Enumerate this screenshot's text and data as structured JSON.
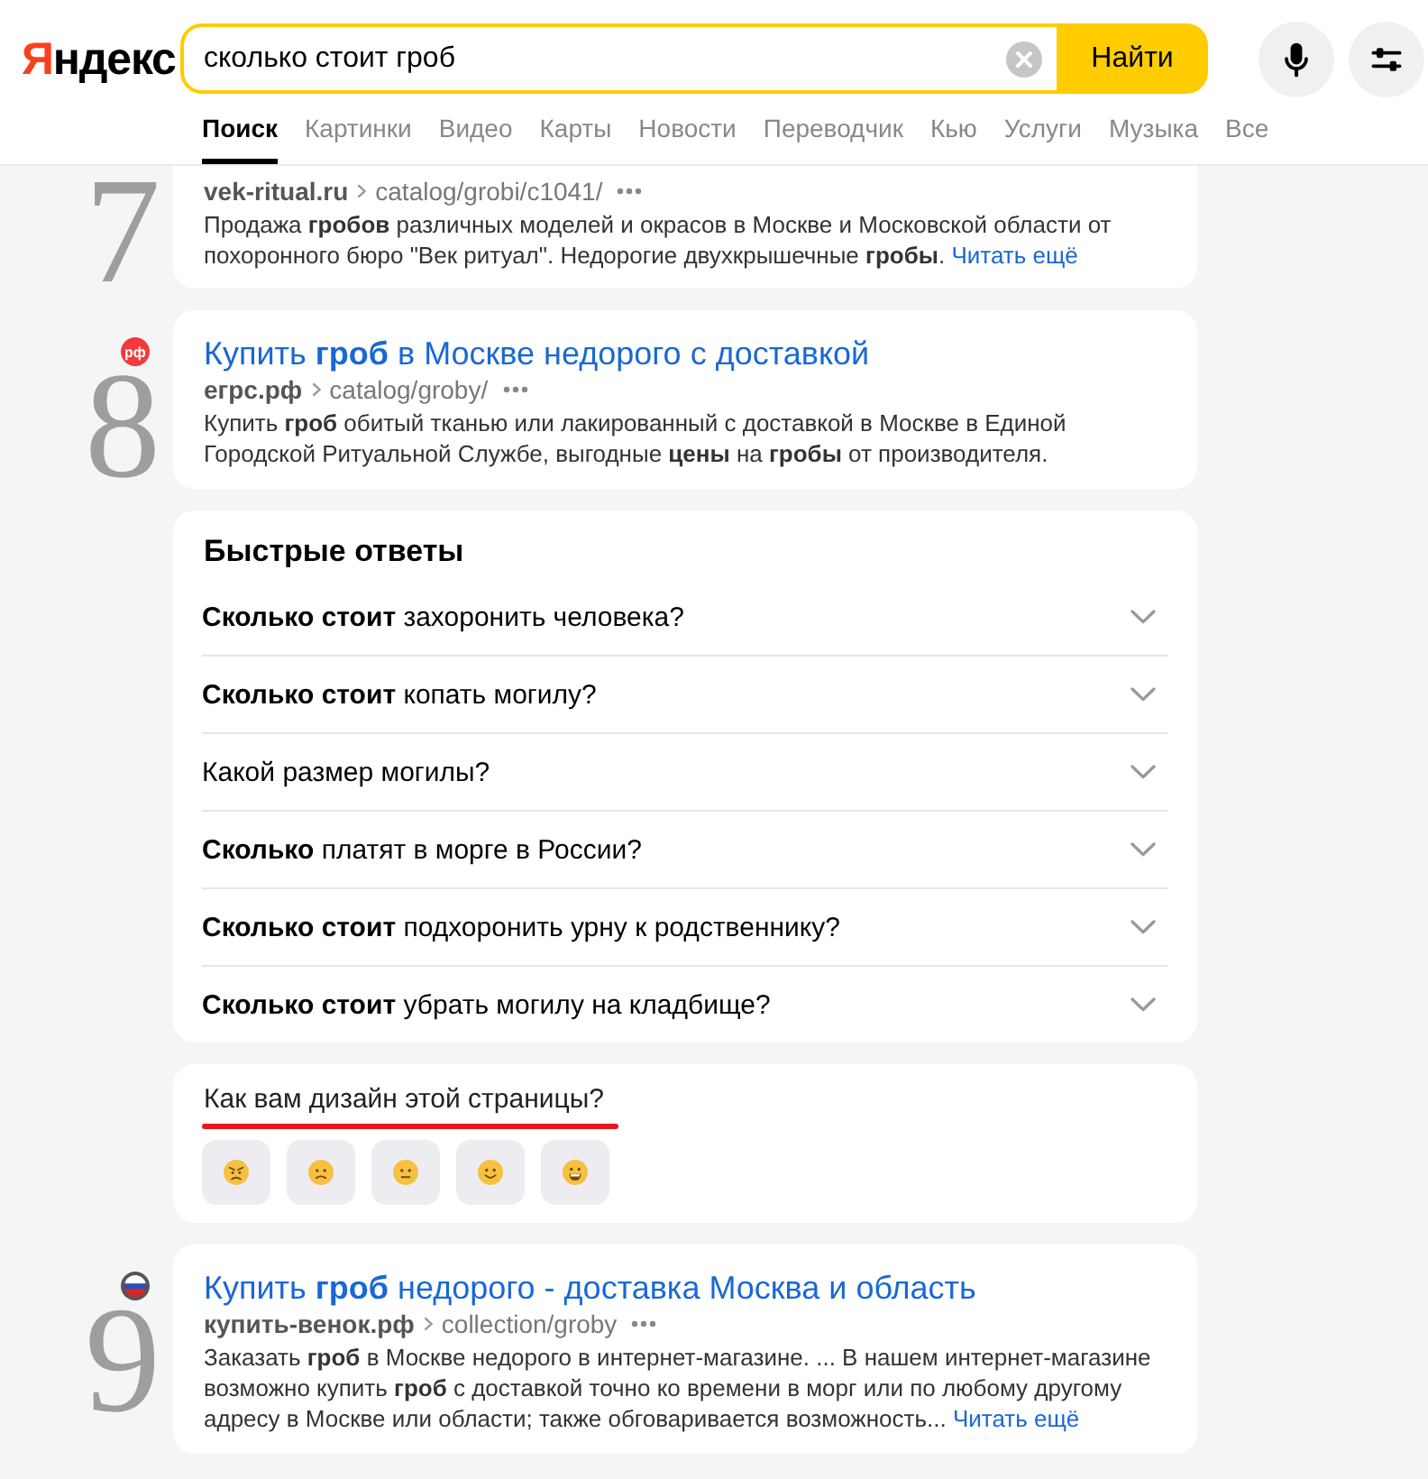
{
  "header": {
    "logo": "Яндекс",
    "search": {
      "value": "сколько стоит гроб"
    },
    "search_button": "Найти",
    "tabs": [
      {
        "label": "Поиск",
        "selected": true
      },
      {
        "label": "Картинки",
        "selected": false
      },
      {
        "label": "Видео",
        "selected": false
      },
      {
        "label": "Карты",
        "selected": false
      },
      {
        "label": "Новости",
        "selected": false
      },
      {
        "label": "Переводчик",
        "selected": false
      },
      {
        "label": "Кью",
        "selected": false
      },
      {
        "label": "Услуги",
        "selected": false
      },
      {
        "label": "Музыка",
        "selected": false
      },
      {
        "label": "Все",
        "selected": false
      }
    ]
  },
  "results": [
    {
      "number": "7",
      "domain": "vek-ritual.ru",
      "path": "catalog/grobi/c1041/",
      "snippet": "Продажа **гробов** различных моделей и окрасов в Москве и Московской области от похоронного бюро \"Век ритуал\". Недорогие двухкрышечные **гробы**.",
      "more_link": "Читать ещё"
    },
    {
      "number": "8",
      "favicon": {
        "kind": "letters",
        "text": "рф"
      },
      "title": "Купить **гроб** в Москве недорого с доставкой",
      "domain": "егрс.рф",
      "path": "catalog/groby/",
      "snippet": "Купить **гроб** обитый тканью или лакированный с доставкой в Москве в Единой Городской Ритуальной Службе, выгодные **цены** на **гробы** от производителя."
    }
  ],
  "quick_answers": {
    "title": "Быстрые ответы",
    "questions": [
      {
        "text": "**Сколько стоит** захоронить человека?",
        "expanded": false
      },
      {
        "text": "**Сколько стоит** копать могилу?",
        "expanded": false
      },
      {
        "text": "Какой размер могилы?",
        "expanded": false
      },
      {
        "text": "**Сколько** платят в морге в России?",
        "expanded": false
      },
      {
        "text": "**Сколько стоит** подхоронить урну к родственнику?",
        "expanded": false
      },
      {
        "text": "**Сколько стоит** убрать могилу на кладбище?",
        "expanded": false
      }
    ]
  },
  "feedback": {
    "question": "Как вам дизайн этой страницы?",
    "underlined": true
  },
  "more_results": [
    {
      "number": "9",
      "favicon": {
        "kind": "flag"
      },
      "title": "Купить **гроб** недорого - доставка Москва и область",
      "domain": "купить-венок.рф",
      "path": "collection/groby",
      "snippet": "Заказать **гроб** в Москве недорого в интернет-магазине. ... В нашем интернет-магазине возможно купить **гроб** с доставкой точно ко времени в морг или по любому другому адресу в Москве или области; также обговаривается возможность...",
      "more_link": "Читать ещё"
    }
  ]
}
